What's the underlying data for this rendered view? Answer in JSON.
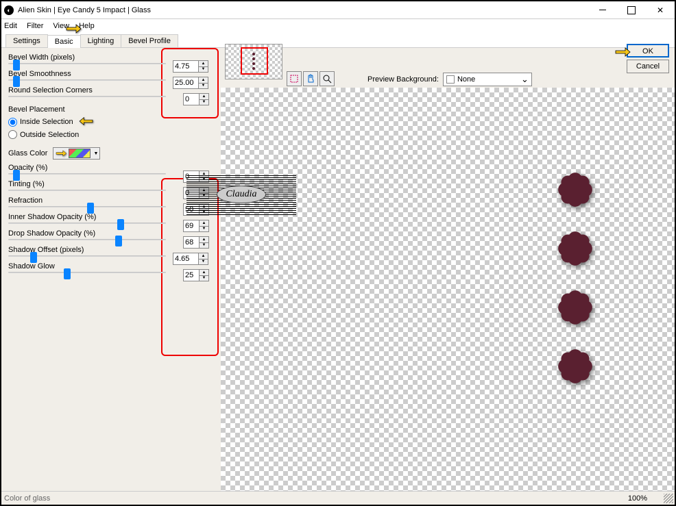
{
  "window": {
    "title": "Alien Skin | Eye Candy 5 Impact | Glass"
  },
  "menu": {
    "edit": "Edit",
    "filter": "Filter",
    "view": "View",
    "help": "Help"
  },
  "tabs": {
    "settings": "Settings",
    "basic": "Basic",
    "lighting": "Lighting",
    "bevel": "Bevel Profile"
  },
  "controls": {
    "bevel_width": {
      "label": "Bevel Width (pixels)",
      "value": "4.75",
      "pos": 3
    },
    "bevel_smooth": {
      "label": "Bevel Smoothness",
      "value": "25.00",
      "pos": 3
    },
    "round_corners": {
      "label": "Round Selection Corners",
      "value": "0",
      "pos": 0
    },
    "bevel_placement": {
      "label": "Bevel Placement",
      "inside": "Inside Selection",
      "outside": "Outside Selection"
    },
    "glass_color": {
      "label": "Glass Color"
    },
    "opacity": {
      "label": "Opacity (%)",
      "value": "0",
      "pos": 3
    },
    "tinting": {
      "label": "Tinting (%)",
      "value": "0",
      "pos": 0
    },
    "refraction": {
      "label": "Refraction",
      "value": "50",
      "pos": 50
    },
    "inner_shadow": {
      "label": "Inner Shadow Opacity (%)",
      "value": "69",
      "pos": 69
    },
    "drop_shadow": {
      "label": "Drop Shadow Opacity (%)",
      "value": "68",
      "pos": 68
    },
    "shadow_offset": {
      "label": "Shadow Offset (pixels)",
      "value": "4.65",
      "pos": 14
    },
    "shadow_glow": {
      "label": "Shadow Glow",
      "value": "25",
      "pos": 35
    }
  },
  "preview": {
    "label": "Preview Background:",
    "value": "None"
  },
  "buttons": {
    "ok": "OK",
    "cancel": "Cancel"
  },
  "status": {
    "left": "Color of glass",
    "zoom": "100%"
  },
  "watermark": "Claudia"
}
